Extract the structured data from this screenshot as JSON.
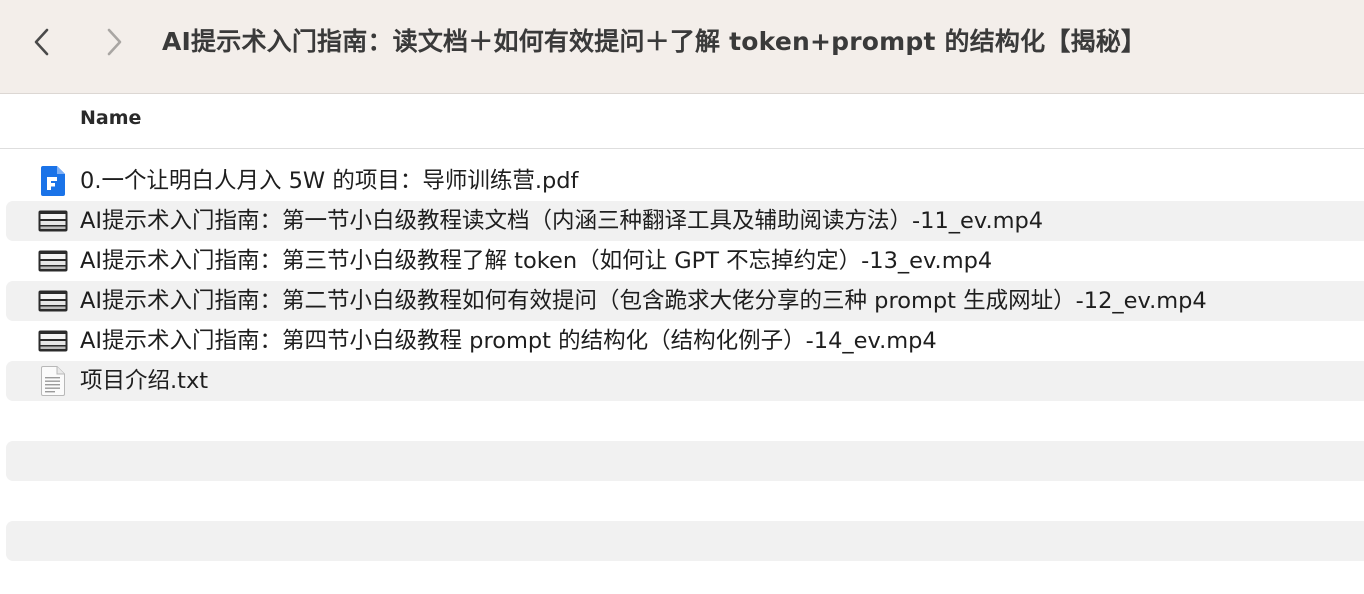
{
  "window": {
    "title": "AI提示术入门指南：读文档＋如何有效提问＋了解 token+prompt 的结构化【揭秘】",
    "nav": {
      "back_icon": "chevron-left-icon",
      "forward_icon": "chevron-right-icon"
    }
  },
  "columns": {
    "name": "Name"
  },
  "files": [
    {
      "name": "0.一个让明白人月入 5W 的项目：导师训练营.pdf",
      "icon": "pdf-file-icon"
    },
    {
      "name": "AI提示术入门指南：第一节小白级教程读文档（内涵三种翻译工具及辅助阅读方法）-11_ev.mp4",
      "icon": "video-file-icon"
    },
    {
      "name": "AI提示术入门指南：第三节小白级教程了解 token（如何让 GPT 不忘掉约定）-13_ev.mp4",
      "icon": "video-file-icon"
    },
    {
      "name": "AI提示术入门指南：第二节小白级教程如何有效提问（包含跪求大佬分享的三种 prompt 生成网址）-12_ev.mp4",
      "icon": "video-file-icon"
    },
    {
      "name": "AI提示术入门指南：第四节小白级教程 prompt 的结构化（结构化例子）-14_ev.mp4",
      "icon": "video-file-icon"
    },
    {
      "name": "项目介绍.txt",
      "icon": "text-file-icon"
    }
  ],
  "colors": {
    "toolbar_bg": "#f3eeea",
    "stripe": "#f1f1f1",
    "pdf_blue": "#1a73e8"
  }
}
